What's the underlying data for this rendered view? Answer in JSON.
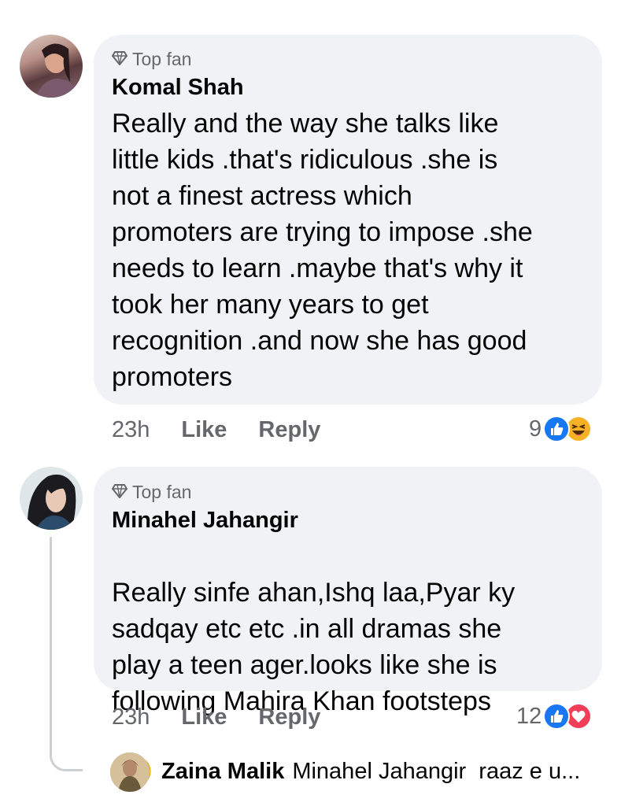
{
  "comments": [
    {
      "badge": "Top fan",
      "author": "Komal Shah",
      "text": "Really and the way she talks like\nlittle kids .that's ridiculous .she is\nnot a finest actress which\npromoters are trying to impose .she\nneeds to learn .maybe that's why it\ntook her many years to get\nrecognition .and now she has good\npromoters",
      "time": "23h",
      "like_label": "Like",
      "reply_label": "Reply",
      "reaction_count": "9",
      "reactions": [
        "like",
        "haha"
      ]
    },
    {
      "badge": "Top fan",
      "author": "Minahel Jahangir",
      "text": "Really sinfe ahan,Ishq laa,Pyar ky\nsadqay etc etc .in all dramas she\nplay a teen ager.looks like she is\nfollowing Mahira Khan footsteps",
      "emoji": "😉",
      "time": "23h",
      "like_label": "Like",
      "reply_label": "Reply",
      "reaction_count": "12",
      "reactions": [
        "like",
        "love"
      ]
    }
  ],
  "reply_preview": {
    "author": "Zaina Malik",
    "text": "Minahel Jahangir  raaz e u..."
  },
  "colors": {
    "bubble": "#f0f2f5",
    "secondary_text": "#65676b",
    "like_blue": "#1877f2",
    "love_red": "#f33e58",
    "haha_yellow": "#f7b125"
  }
}
